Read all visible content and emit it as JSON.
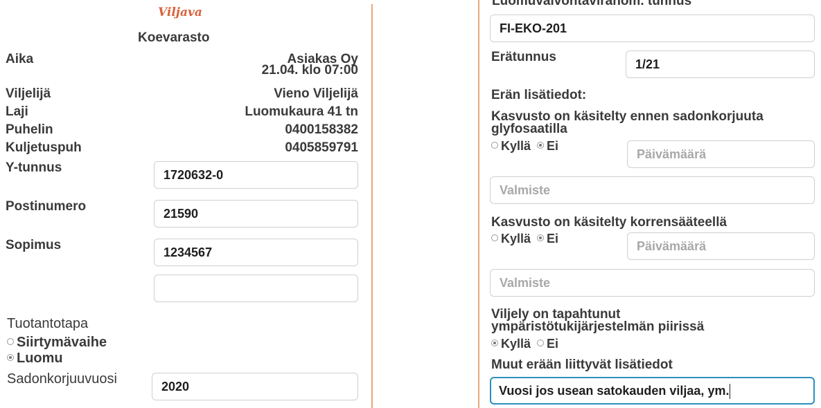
{
  "brand": {
    "logo_text": "Viljava",
    "title": "Koevarasto",
    "accent": "#e8a777",
    "logo_color": "#d8623a"
  },
  "left": {
    "info": [
      {
        "label": "Aika",
        "value": "Asiakas Oy"
      },
      {
        "label": "",
        "value": "21.04. klo 07:00"
      },
      {
        "label": "Viljelijä",
        "value": "Vieno Viljelijä"
      },
      {
        "label": "Laji",
        "value": "Luomukaura 41 tn"
      },
      {
        "label": "Puhelin",
        "value": "0400158382"
      },
      {
        "label": "Kuljetuspuh",
        "value": "0405859791"
      }
    ],
    "fields": {
      "ytunnus": {
        "label": "Y-tunnus",
        "value": "1720632-0"
      },
      "postinumero": {
        "label": "Postinumero",
        "value": "21590"
      },
      "sopimus": {
        "label": "Sopimus",
        "value": "1234567"
      },
      "extra": {
        "value": ""
      }
    },
    "tuotantotapa": {
      "label": "Tuotantotapa",
      "options": [
        {
          "label": "Siirtymävaihe",
          "selected": false
        },
        {
          "label": "Luomu",
          "selected": true
        }
      ]
    },
    "sadonkorjuuvuosi": {
      "label": "Sadonkorjuuvuosi",
      "value": "2020"
    }
  },
  "right": {
    "luomu_tunnus": {
      "label": "Luomuvalvontaviranom. tunnus",
      "value": "FI-EKO-201"
    },
    "eratunnus": {
      "label": "Erätunnus",
      "value": "1/21"
    },
    "eran_lisatiedot_label": "Erän lisätiedot:",
    "glyfosaatti": {
      "question_line1": "Kasvusto on käsitelty ennen sadonkorjuuta",
      "question_line2": "glyfosaatilla",
      "yes": "Kyllä",
      "no": "Ei",
      "selected": "no",
      "date_placeholder": "Päivämäärä",
      "product_placeholder": "Valmiste"
    },
    "korrensaate": {
      "question": "Kasvusto on käsitelty korrensääteellä",
      "yes": "Kyllä",
      "no": "Ei",
      "selected": "no",
      "date_placeholder": "Päivämäärä",
      "product_placeholder": "Valmiste"
    },
    "ymparisto": {
      "question_line1": "Viljely on tapahtunut",
      "question_line2": "ympäristötukijärjestelmän piirissä",
      "yes": "Kyllä",
      "no": "Ei",
      "selected": "yes"
    },
    "muut": {
      "label": "Muut erään liittyvät lisätiedot",
      "value": "Vuosi jos usean satokauden viljaa, ym."
    }
  }
}
